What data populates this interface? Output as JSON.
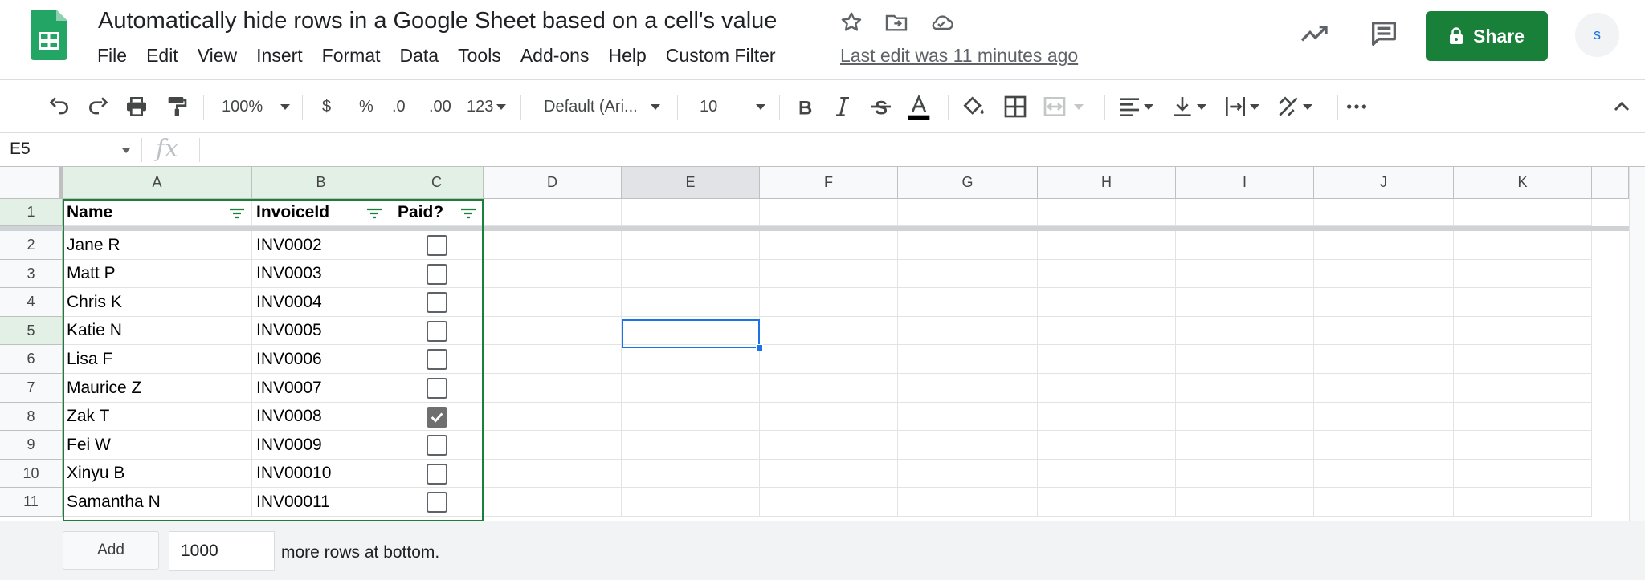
{
  "app": {
    "name": "Google Sheets",
    "logo_icon": "sheets-logo-icon",
    "brand_color": "#188038"
  },
  "document": {
    "title": "Automatically hide rows in a Google Sheet based on a cell's value"
  },
  "title_icons": [
    "star-icon",
    "move-to-folder-icon",
    "cloud-saved-icon"
  ],
  "menu": [
    "File",
    "Edit",
    "View",
    "Insert",
    "Format",
    "Data",
    "Tools",
    "Add-ons",
    "Help",
    "Custom Filter"
  ],
  "last_edit": "Last edit was 11 minutes ago",
  "header_icons": [
    "explore-trend-icon",
    "comment-icon"
  ],
  "share": {
    "label": "Share",
    "icon": "lock-icon"
  },
  "avatar": {
    "initial": "s"
  },
  "toolbar": {
    "zoom": "100%",
    "currency": "$",
    "percent": "%",
    "decrease_decimal": ".0",
    "increase_decimal": ".00",
    "more_formats": "123",
    "font": "Default (Ari...",
    "font_size": "10"
  },
  "formula_bar": {
    "cell_ref": "E5",
    "fx": "fx",
    "value": ""
  },
  "columns": [
    "A",
    "B",
    "C",
    "D",
    "E",
    "F",
    "G",
    "H",
    "I",
    "J",
    "K"
  ],
  "headers": {
    "name": "Name",
    "invoice": "InvoiceId",
    "paid": "Paid?"
  },
  "rows": [
    {
      "num": "1"
    },
    {
      "num": "2",
      "name": "Jane R",
      "invoice": "INV0002",
      "paid": false
    },
    {
      "num": "3",
      "name": "Matt P",
      "invoice": "INV0003",
      "paid": false
    },
    {
      "num": "4",
      "name": "Chris K",
      "invoice": "INV0004",
      "paid": false
    },
    {
      "num": "5",
      "name": "Katie N",
      "invoice": "INV0005",
      "paid": false
    },
    {
      "num": "6",
      "name": "Lisa F",
      "invoice": "INV0006",
      "paid": false
    },
    {
      "num": "7",
      "name": "Maurice Z",
      "invoice": "INV0007",
      "paid": false
    },
    {
      "num": "8",
      "name": "Zak T",
      "invoice": "INV0008",
      "paid": true
    },
    {
      "num": "9",
      "name": "Fei W",
      "invoice": "INV0009",
      "paid": false
    },
    {
      "num": "10",
      "name": "Xinyu B",
      "invoice": "INV00010",
      "paid": false
    },
    {
      "num": "11",
      "name": "Samantha N",
      "invoice": "INV00011",
      "paid": false
    }
  ],
  "selection": {
    "active_cell": "E5",
    "color": "#1a73e8"
  },
  "footer": {
    "add_label": "Add",
    "rows_value": "1000",
    "suffix": "more rows at bottom."
  }
}
